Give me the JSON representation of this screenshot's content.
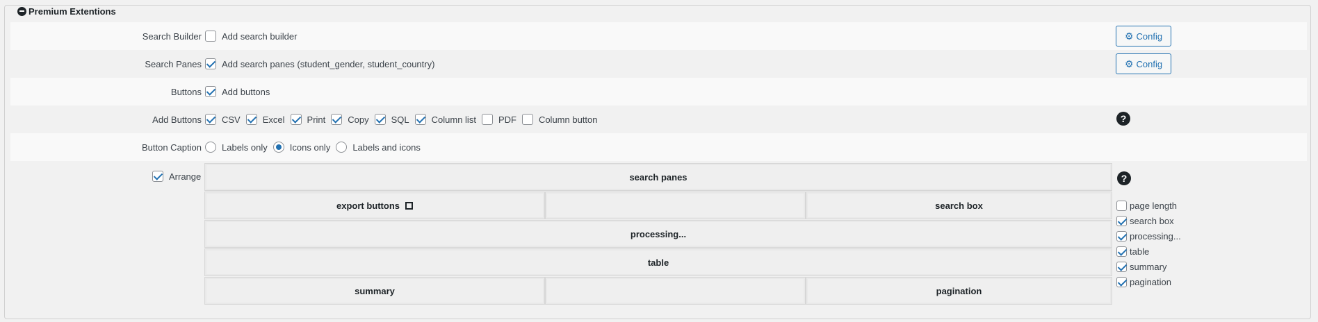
{
  "legend": {
    "title": "Premium Extentions"
  },
  "search_builder": {
    "label": "Search Builder",
    "option": "Add search builder",
    "checked": false,
    "config": "Config"
  },
  "search_panes": {
    "label": "Search Panes",
    "option": "Add search panes (student_gender, student_country)",
    "checked": true,
    "config": "Config"
  },
  "buttons": {
    "label": "Buttons",
    "option": "Add buttons",
    "checked": true
  },
  "add_buttons": {
    "label": "Add Buttons",
    "items": [
      {
        "label": "CSV",
        "checked": true
      },
      {
        "label": "Excel",
        "checked": true
      },
      {
        "label": "Print",
        "checked": true
      },
      {
        "label": "Copy",
        "checked": true
      },
      {
        "label": "SQL",
        "checked": true
      },
      {
        "label": "Column list",
        "checked": true
      },
      {
        "label": "PDF",
        "checked": false
      },
      {
        "label": "Column button",
        "checked": false
      }
    ]
  },
  "button_caption": {
    "label": "Button Caption",
    "options": [
      {
        "label": "Labels only",
        "selected": false
      },
      {
        "label": "Icons only",
        "selected": true
      },
      {
        "label": "Labels and icons",
        "selected": false
      }
    ]
  },
  "arrange": {
    "label": "Arrange",
    "checked": true,
    "grid": {
      "row1": "search panes",
      "row2": [
        "export buttons",
        "",
        "search box"
      ],
      "row3": "processing...",
      "row4": "table",
      "row5": [
        "summary",
        "",
        "pagination"
      ]
    },
    "side_list": [
      {
        "label": "page length",
        "checked": false
      },
      {
        "label": "search box",
        "checked": true
      },
      {
        "label": "processing...",
        "checked": true
      },
      {
        "label": "table",
        "checked": true
      },
      {
        "label": "summary",
        "checked": true
      },
      {
        "label": "pagination",
        "checked": true
      }
    ]
  },
  "icons": {
    "help": "question-circle-icon",
    "config": "gear-icon",
    "collapse": "minus-circle-icon",
    "expand": "expand-icon"
  },
  "colors": {
    "accent": "#2271b1",
    "background": "#f1f1f1",
    "row_light": "#f9f9f9"
  }
}
